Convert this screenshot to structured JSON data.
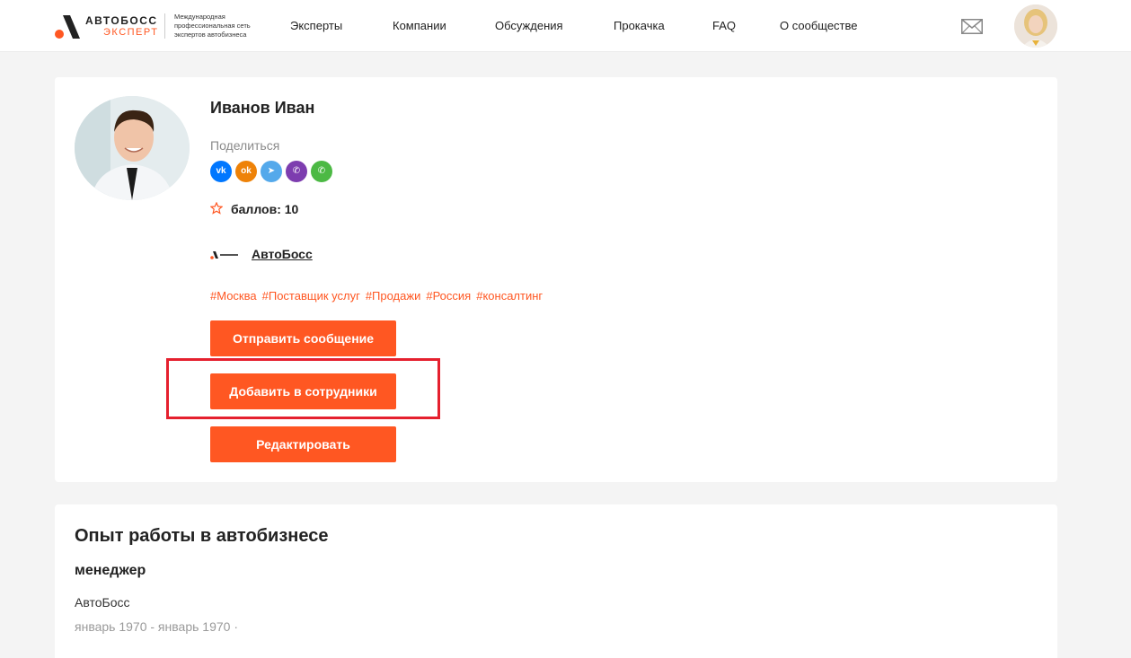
{
  "brand": {
    "title": "АВТОБОСС",
    "subtitle": "ЭКСПЕРТ",
    "description": "Международная профессиональная сеть экспертов автобизнеса",
    "accent": "#ff5722"
  },
  "nav": {
    "items": [
      {
        "label": "Эксперты"
      },
      {
        "label": "Компании"
      },
      {
        "label": "Обсуждения"
      },
      {
        "label": "Прокачка"
      },
      {
        "label": "FAQ"
      },
      {
        "label": "О сообществе"
      }
    ]
  },
  "header_icons": {
    "mail": "mail-icon",
    "avatar": "user-avatar"
  },
  "profile": {
    "name": "Иванов Иван",
    "share_label": "Поделиться",
    "socials": [
      {
        "icon": "vk-icon",
        "glyph": "vk",
        "color": "#0077ff"
      },
      {
        "icon": "odnoklassniki-icon",
        "glyph": "ok",
        "color": "#ee8208"
      },
      {
        "icon": "telegram-icon",
        "glyph": "➤",
        "color": "#54a9eb"
      },
      {
        "icon": "viber-icon",
        "glyph": "✆",
        "color": "#7d3daf"
      },
      {
        "icon": "whatsapp-icon",
        "glyph": "✆",
        "color": "#4cb944"
      }
    ],
    "points_label": "баллов: 10",
    "company": "АвтоБосс",
    "tags": [
      "#Москва",
      "#Поставщик услуг",
      "#Продажи",
      "#Россия",
      "#консалтинг"
    ],
    "buttons": {
      "send_message": "Отправить сообщение",
      "add_employee": "Добавить в сотрудники",
      "edit": "Редактировать"
    },
    "highlight_color": "#e5202e"
  },
  "experience": {
    "title": "Опыт работы в автобизнесе",
    "role": "менеджер",
    "company": "АвтоБосс",
    "dates": "январь 1970 - январь 1970 ·"
  }
}
